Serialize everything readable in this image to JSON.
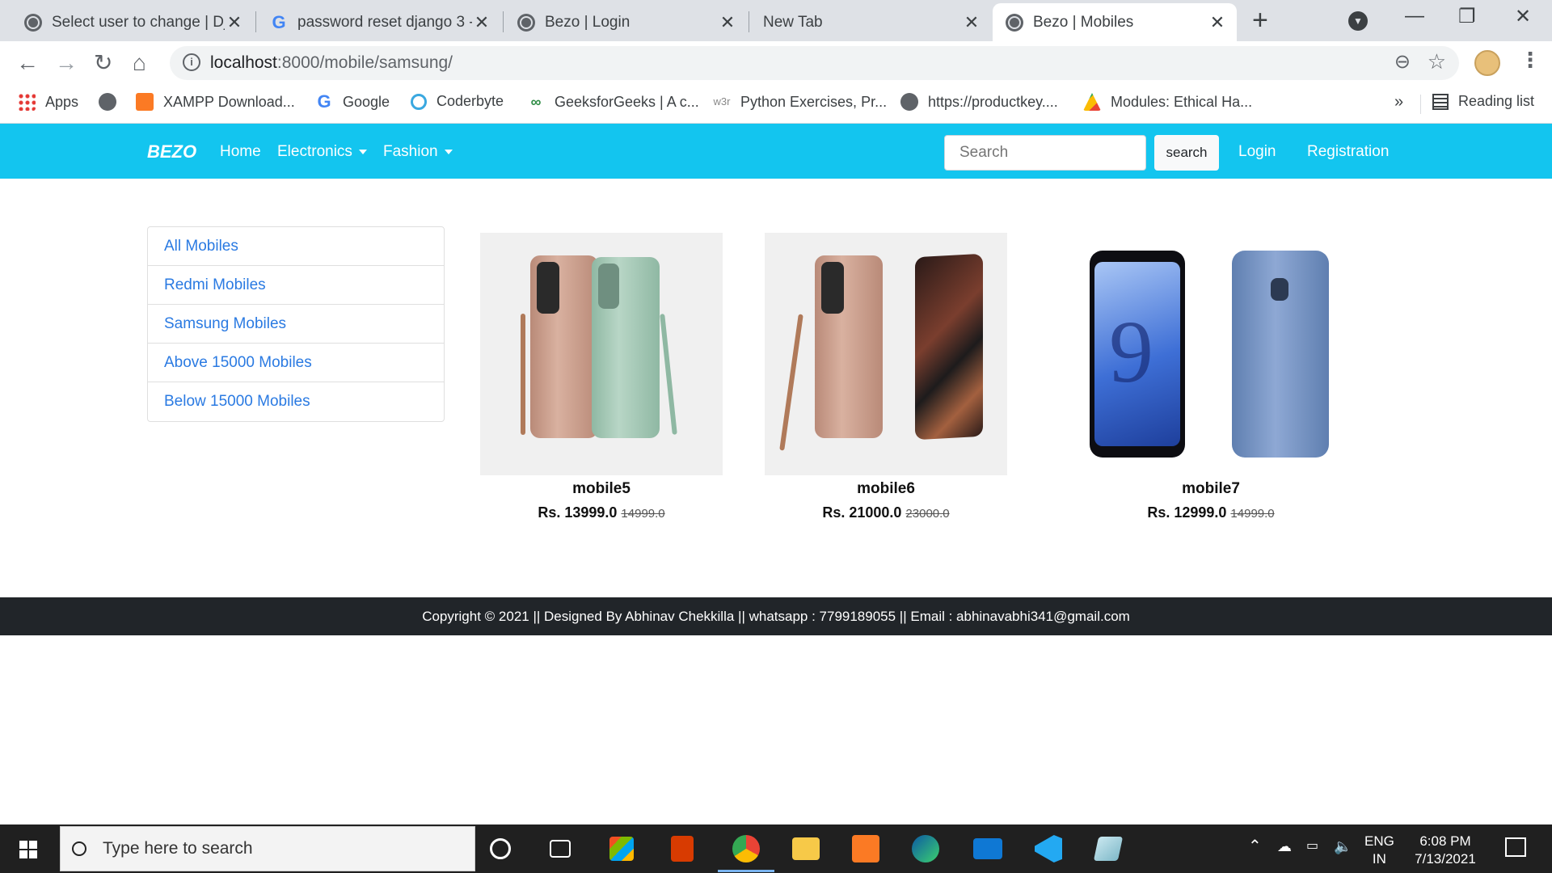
{
  "browser": {
    "tabs": [
      {
        "title": "Select user to change | Dja",
        "favicon": "globe-icon",
        "active": false
      },
      {
        "title": "password reset django 3 - ",
        "favicon": "google-icon",
        "active": false
      },
      {
        "title": "Bezo | Login",
        "favicon": "globe-icon",
        "active": false
      },
      {
        "title": "New Tab",
        "favicon": "",
        "active": false
      },
      {
        "title": "Bezo | Mobiles",
        "favicon": "globe-icon",
        "active": true
      }
    ],
    "url_host": "localhost",
    "url_path": ":8000/mobile/samsung/",
    "bookmarks": [
      {
        "label": "Apps",
        "icon": "apps-grid-icon"
      },
      {
        "label": "",
        "icon": "globe-icon"
      },
      {
        "label": "XAMPP Download...",
        "icon": "xampp-icon"
      },
      {
        "label": "Google",
        "icon": "google-icon"
      },
      {
        "label": "Coderbyte",
        "icon": "coderbyte-icon"
      },
      {
        "label": "GeeksforGeeks | A c...",
        "icon": "gfg-icon"
      },
      {
        "label": "Python Exercises, Pr...",
        "icon": "w3-icon"
      },
      {
        "label": "https://productkey....",
        "icon": "globe-icon"
      },
      {
        "label": "Modules: Ethical Ha...",
        "icon": "drive-icon"
      }
    ],
    "reading_list": "Reading list"
  },
  "site": {
    "brand": "BEZO",
    "nav": {
      "home": "Home",
      "electronics": "Electronics",
      "fashion": "Fashion",
      "login": "Login",
      "registration": "Registration"
    },
    "search": {
      "placeholder": "Search",
      "button": "search"
    },
    "accent": "#13c5ef"
  },
  "sidebar": {
    "items": [
      "All Mobiles",
      "Redmi Mobiles",
      "Samsung Mobiles",
      "Above 15000 Mobiles",
      "Below 15000 Mobiles"
    ]
  },
  "products": [
    {
      "name": "mobile5",
      "price": "Rs. 13999.0",
      "old_price": "14999.0"
    },
    {
      "name": "mobile6",
      "price": "Rs. 21000.0",
      "old_price": "23000.0"
    },
    {
      "name": "mobile7",
      "price": "Rs. 12999.0",
      "old_price": "14999.0"
    }
  ],
  "footer": {
    "text": "Copyright © 2021 || Designed By Abhinav Chekkilla || whatsapp : 7799189055 || Email : abhinavabhi341@gmail.com"
  },
  "taskbar": {
    "search_placeholder": "Type here to search",
    "lang": "ENG",
    "region": "IN",
    "time": "6:08 PM",
    "date": "7/13/2021"
  }
}
